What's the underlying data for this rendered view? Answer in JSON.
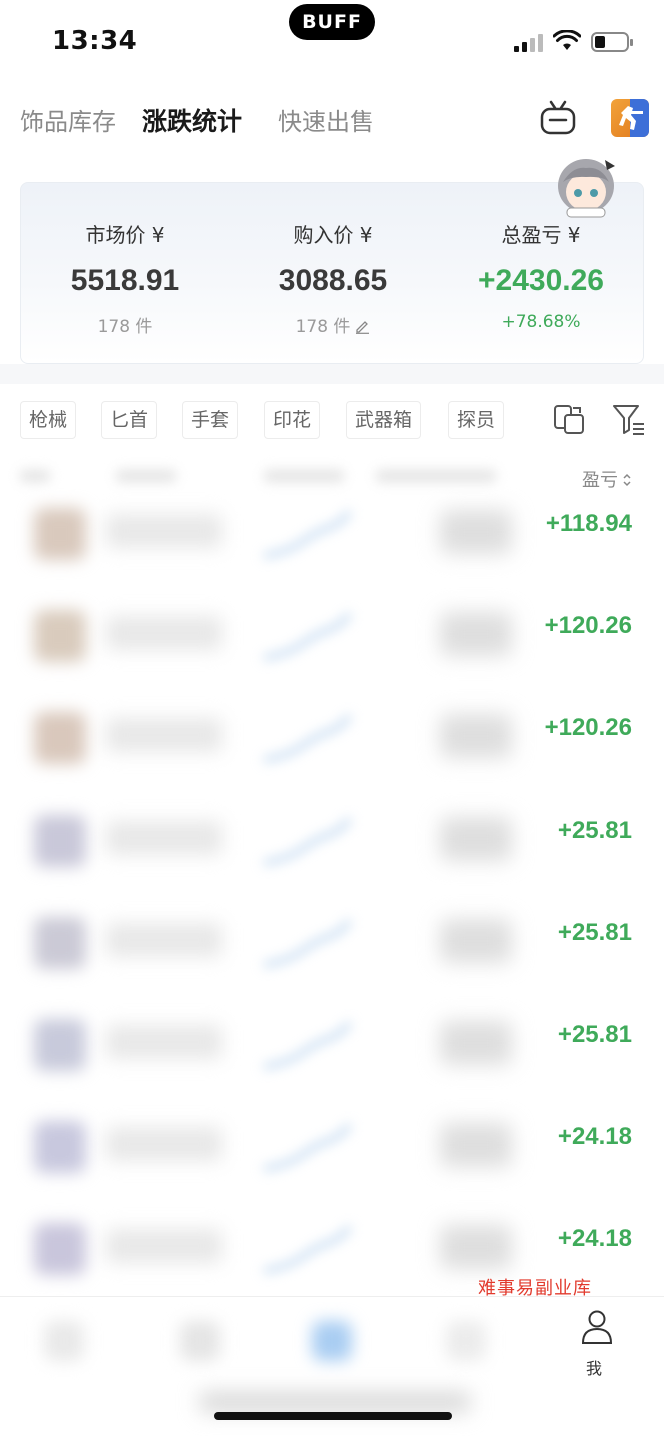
{
  "status_bar": {
    "time": "13:34",
    "island_text": "BUFF"
  },
  "top_nav": {
    "tabs": [
      {
        "label": "饰品库存",
        "active": false
      },
      {
        "label": "涨跌统计",
        "active": true
      },
      {
        "label": "快速出售",
        "active": false
      }
    ],
    "icons": [
      "robot-icon",
      "game-switch-icon"
    ]
  },
  "summary": {
    "market": {
      "label": "市场价 ¥",
      "value": "5518.91",
      "count": "178 件"
    },
    "purchase": {
      "label": "购入价 ¥",
      "value": "3088.65",
      "count": "178 件"
    },
    "profit": {
      "label": "总盈亏 ¥",
      "value": "+2430.26",
      "percent": "+78.68%"
    }
  },
  "filters": [
    "枪械",
    "匕首",
    "手套",
    "印花",
    "武器箱",
    "探员"
  ],
  "list": {
    "sort_label": "盈亏",
    "rows": [
      {
        "profit": "+118.94",
        "tone": "#d9c9bd"
      },
      {
        "profit": "+120.26",
        "tone": "#d9cbbd"
      },
      {
        "profit": "+120.26",
        "tone": "#d9c8bc"
      },
      {
        "profit": "+25.81",
        "tone": "#c9c8d9"
      },
      {
        "profit": "+25.81",
        "tone": "#cbcad6"
      },
      {
        "profit": "+25.81",
        "tone": "#c8cadb"
      },
      {
        "profit": "+24.18",
        "tone": "#c8c8de"
      },
      {
        "profit": "+24.18",
        "tone": "#c9c6dc"
      }
    ]
  },
  "bottom_bar": {
    "me_label": "我"
  },
  "watermark": "难事易副业库",
  "colors": {
    "profit_green": "#3faa5a",
    "accent_blue": "#3d6fd8"
  }
}
